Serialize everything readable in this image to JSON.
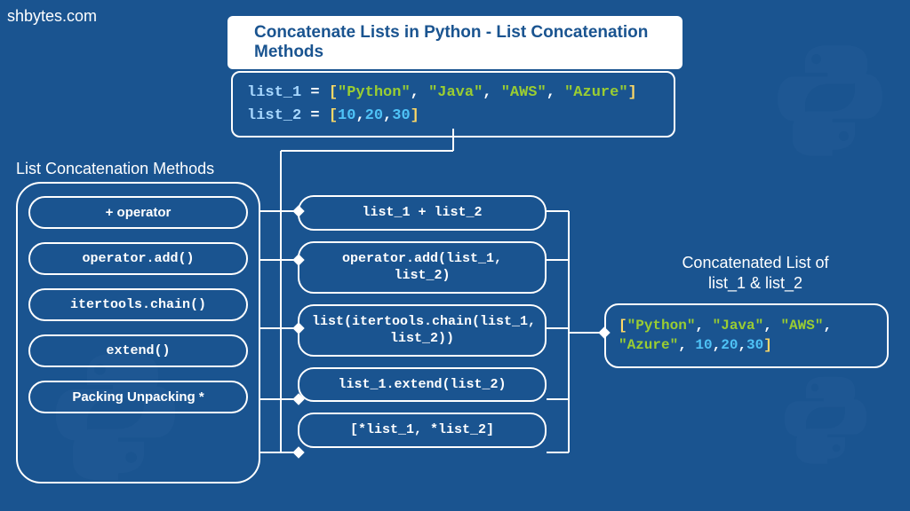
{
  "brand": "shbytes.com",
  "title": "Concatenate Lists in Python - List Concatenation Methods",
  "definition": {
    "var1": "list_1",
    "val1_parts": [
      "\"Python\"",
      "\"Java\"",
      "\"AWS\"",
      "\"Azure\""
    ],
    "var2": "list_2",
    "val2_parts": [
      "10",
      "20",
      "30"
    ]
  },
  "methods_label": "List Concatenation Methods",
  "methods": [
    {
      "label": "+ operator",
      "font": "sans"
    },
    {
      "label": "operator.add()",
      "font": "mono"
    },
    {
      "label": "itertools.chain()",
      "font": "mono"
    },
    {
      "label": "extend()",
      "font": "mono"
    },
    {
      "label": "Packing Unpacking *",
      "font": "sans"
    }
  ],
  "examples": [
    "list_1 + list_2",
    "operator.add(list_1, list_2)",
    "list(itertools.chain(list_1, list_2))",
    "list_1.extend(list_2)",
    "[*list_1, *list_2]"
  ],
  "result_label_line1": "Concatenated List of",
  "result_label_line2": "list_1 & list_2",
  "result_parts": {
    "strings": [
      "\"Python\"",
      "\"Java\"",
      "\"AWS\"",
      "\"Azure\""
    ],
    "numbers": [
      "10",
      "20",
      "30"
    ]
  }
}
